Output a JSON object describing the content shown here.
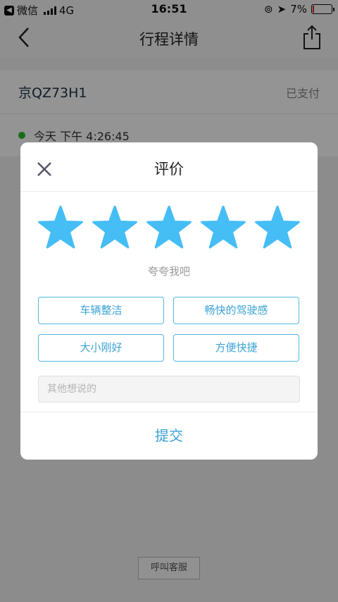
{
  "status_bar": {
    "app_back": "微信",
    "network": "4G",
    "time": "16:51",
    "battery": "7%"
  },
  "nav": {
    "title": "行程详情"
  },
  "trip": {
    "plate": "京QZ73H1",
    "status": "已支付",
    "start_time": "今天 下午 4:26:45"
  },
  "support_button": "呼叫客服",
  "rating_dialog": {
    "title": "评价",
    "star_count": 5,
    "star_color": "#45bdf5",
    "prompt": "夸夸我吧",
    "tags": [
      "车辆整洁",
      "畅快的驾驶感",
      "大小刚好",
      "方便快捷"
    ],
    "remark_placeholder": "其他想说的",
    "submit_label": "提交"
  }
}
